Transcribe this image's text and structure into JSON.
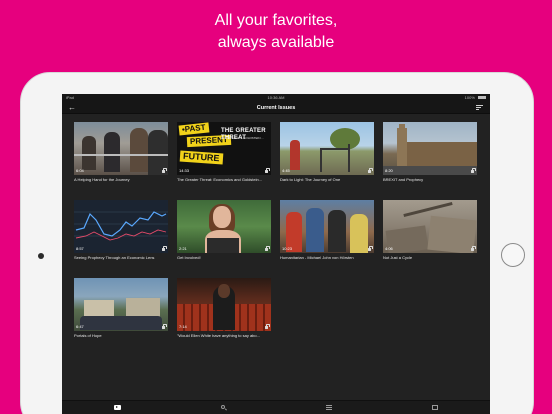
{
  "headline": {
    "line1": "All your favorites,",
    "line2": "always available"
  },
  "status_bar": {
    "carrier": "iPad",
    "time": "10:36 AM",
    "battery": "100%"
  },
  "nav": {
    "title": "Current Issues"
  },
  "videos": [
    {
      "title": "A Helping Hand for the Journey",
      "duration": "6:04",
      "scene": "crowd",
      "locked": true
    },
    {
      "title": "The Greater Threat: Economics and Goldstein...",
      "duration": "14:33",
      "scene": "past-present-future",
      "locked": true,
      "thumb_text": {
        "past": "•PAST",
        "present": "PRESENT",
        "future": "FUTURE",
        "banner": "THE GREATER THREAT",
        "sub": "ECONOMICS & GOLDSTEIN ..."
      }
    },
    {
      "title": "Dark to Light: The Journey of One",
      "duration": "4:45",
      "scene": "playground",
      "locked": true
    },
    {
      "title": "BREXIT and Prophecy",
      "duration": "8:20",
      "scene": "london",
      "locked": true
    },
    {
      "title": "Seeing Prophecy Through an Economic Lens",
      "duration": "8:57",
      "scene": "graph",
      "locked": true
    },
    {
      "title": "Get Involved!",
      "duration": "2:21",
      "scene": "woman",
      "locked": true
    },
    {
      "title": "Humanitarian - Michael John von Hörsten",
      "duration": "10:23",
      "scene": "people",
      "locked": true
    },
    {
      "title": "Not Just a Cycle",
      "duration": "4:06",
      "scene": "rubble",
      "locked": true
    },
    {
      "title": "Portals of Hope",
      "duration": "6:47",
      "scene": "camp",
      "locked": true
    },
    {
      "title": "\"Would Ellen White have anything to say abo...",
      "duration": "7:14",
      "scene": "theater",
      "locked": true
    }
  ],
  "tabs": [
    {
      "icon": "video-icon",
      "active": true
    },
    {
      "icon": "search-icon",
      "active": false
    },
    {
      "icon": "list-icon",
      "active": false
    },
    {
      "icon": "book-icon",
      "active": false
    }
  ],
  "colors": {
    "background": "#e6007e",
    "screen": "#222222",
    "bars": "#161616"
  }
}
